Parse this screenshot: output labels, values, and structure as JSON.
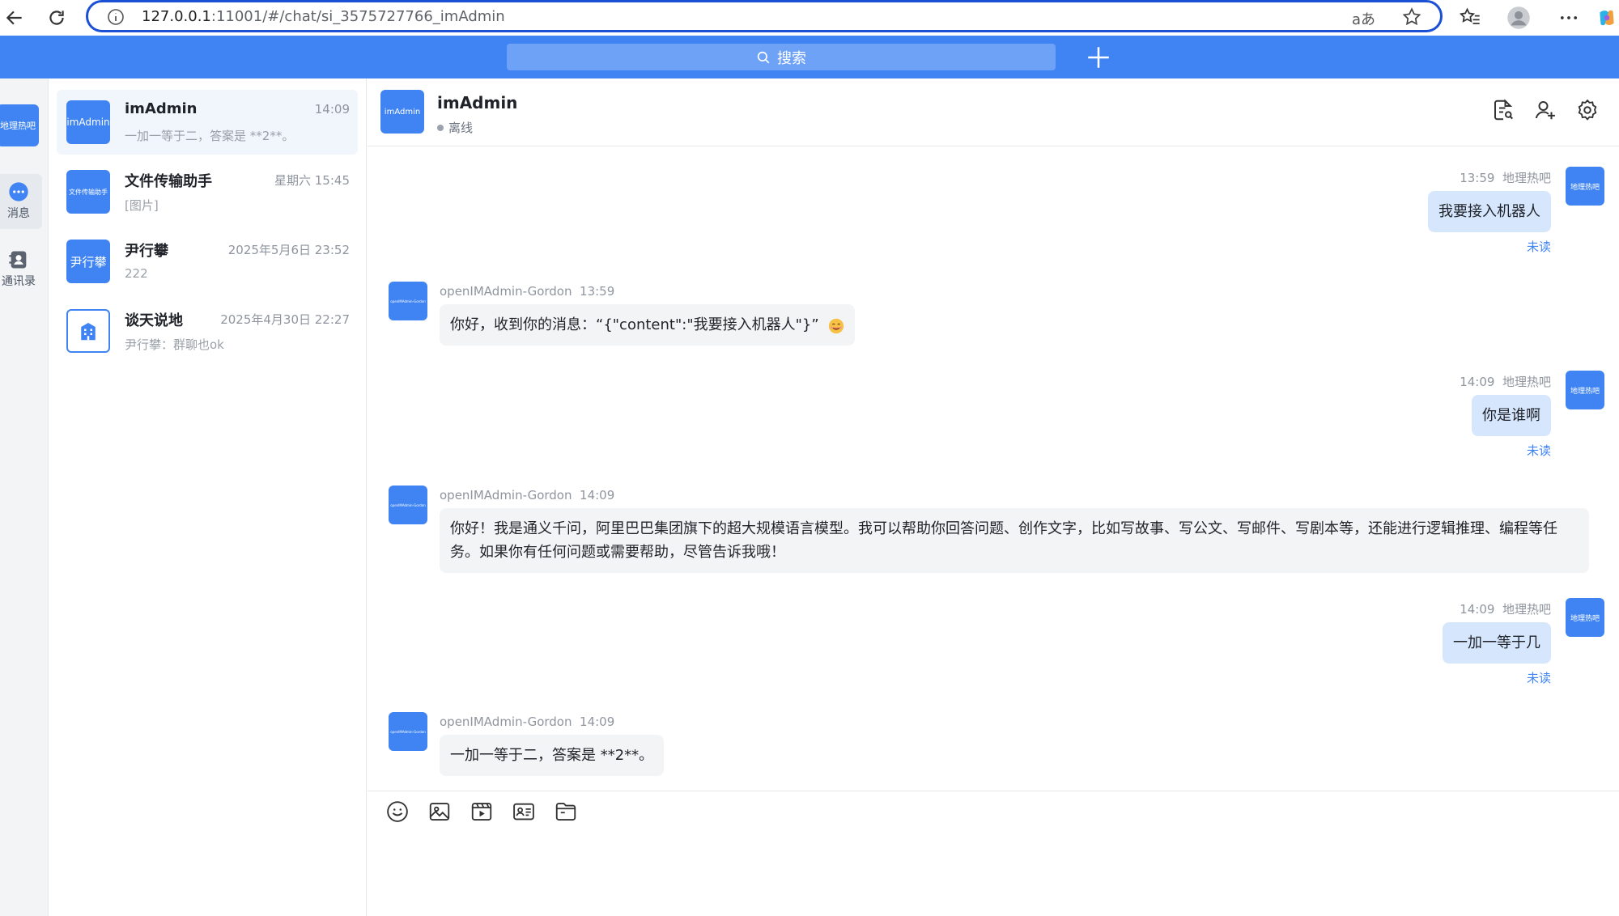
{
  "browser": {
    "url_host": "127.0.0.1",
    "url_path": ":11001/#/chat/si_3575727766_imAdmin",
    "read_aloud_label": "aあ"
  },
  "header": {
    "search_label": "搜索"
  },
  "rail": {
    "me_avatar_text": "地理热吧",
    "items": [
      {
        "label": "消息"
      },
      {
        "label": "通讯录"
      }
    ]
  },
  "conversations": [
    {
      "avatar_text": "imAdmin",
      "name": "imAdmin",
      "time": "14:09",
      "preview": "一加一等于二，答案是 **2**。"
    },
    {
      "avatar_text": "文件传输助手",
      "name": "文件传输助手",
      "time": "星期六 15:45",
      "preview": "[图片]"
    },
    {
      "avatar_text": "尹行攀",
      "name": "尹行攀",
      "time": "2025年5月6日 23:52",
      "preview": "222"
    },
    {
      "avatar_text": "",
      "name": "谈天说地",
      "time": "2025年4月30日 22:27",
      "preview": "尹行攀：群聊也ok"
    }
  ],
  "chat": {
    "avatar_text": "imAdmin",
    "title": "imAdmin",
    "status": "离线",
    "messages": [
      {
        "dir": "out",
        "time": "13:59",
        "sender": "地理热吧",
        "avatar_text": "地理热吧",
        "text": "我要接入机器人",
        "read_state": "未读"
      },
      {
        "dir": "in",
        "time": "13:59",
        "sender": "openIMAdmin-Gordon",
        "avatar_text": "openIMAdmin-Gordon",
        "text": "你好，收到你的消息：“{\"content\":\"我要接入机器人\"}”"
      },
      {
        "dir": "out",
        "time": "14:09",
        "sender": "地理热吧",
        "avatar_text": "地理热吧",
        "text": "你是谁啊",
        "read_state": "未读"
      },
      {
        "dir": "in",
        "time": "14:09",
        "sender": "openIMAdmin-Gordon",
        "avatar_text": "openIMAdmin-Gordon",
        "text": "你好！我是通义千问，阿里巴巴集团旗下的超大规模语言模型。我可以帮助你回答问题、创作文字，比如写故事、写公文、写邮件、写剧本等，还能进行逻辑推理、编程等任务。如果你有任何问题或需要帮助，尽管告诉我哦！"
      },
      {
        "dir": "out",
        "time": "14:09",
        "sender": "地理热吧",
        "avatar_text": "地理热吧",
        "text": "一加一等于几",
        "read_state": "未读"
      },
      {
        "dir": "in",
        "time": "14:09",
        "sender": "openIMAdmin-Gordon",
        "avatar_text": "openIMAdmin-Gordon",
        "text": "一加一等于二，答案是 **2**。"
      }
    ]
  },
  "colors": {
    "brand": "#3f84f2",
    "bubble_out": "#d6e6fd",
    "bubble_in": "#f3f4f6",
    "unread": "#3f84f2"
  }
}
